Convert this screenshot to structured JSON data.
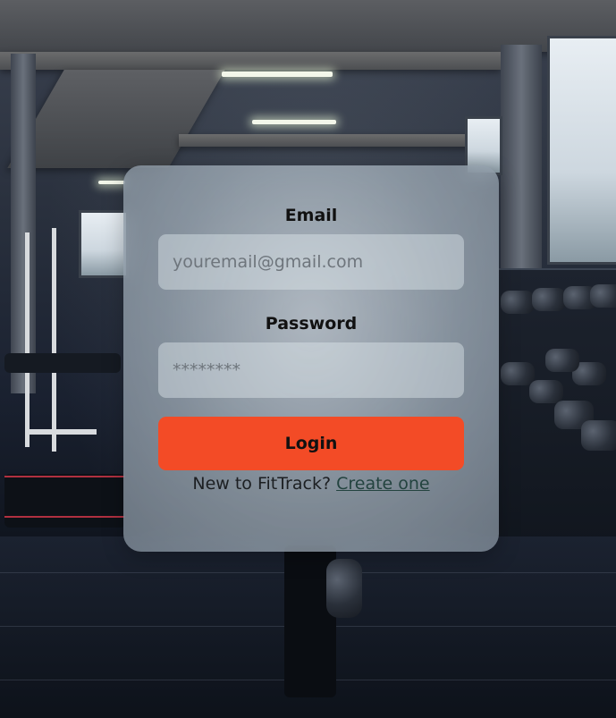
{
  "login_form": {
    "email_label": "Email",
    "email_placeholder": "youremail@gmail.com",
    "password_label": "Password",
    "password_placeholder": "********",
    "login_button": "Login",
    "signup_prompt": "New to FitTrack?",
    "signup_link": "Create one"
  },
  "colors": {
    "login_button": "#f34b26",
    "link": "#23433f"
  }
}
